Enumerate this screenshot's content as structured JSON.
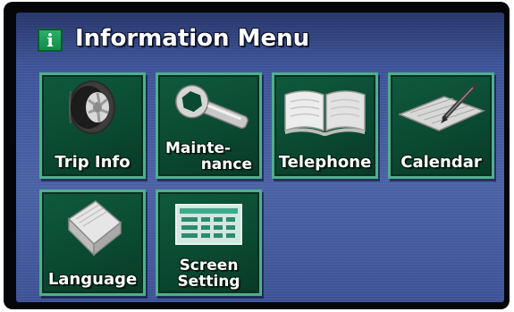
{
  "header": {
    "icon": "info-icon",
    "icon_glyph": "i",
    "title": "Information Menu"
  },
  "menu": {
    "trip_info": {
      "label": "Trip Info",
      "icon": "tire-icon"
    },
    "maintenance": {
      "label_line1": "Mainte-",
      "label_line2": "nance",
      "icon": "wrench-icon"
    },
    "telephone": {
      "label": "Telephone",
      "icon": "book-icon"
    },
    "calendar": {
      "label": "Calendar",
      "icon": "calendar-pen-icon"
    },
    "language": {
      "label": "Language",
      "icon": "language-book-icon"
    },
    "screen_setting": {
      "label_line1": "Screen",
      "label_line2": "Setting",
      "icon": "screen-settings-icon"
    }
  },
  "colors": {
    "tile": "#0b4a32",
    "tile_border": "#4fae8e",
    "screen": "#4a61a4",
    "accent_green": "#1f9e5c"
  }
}
